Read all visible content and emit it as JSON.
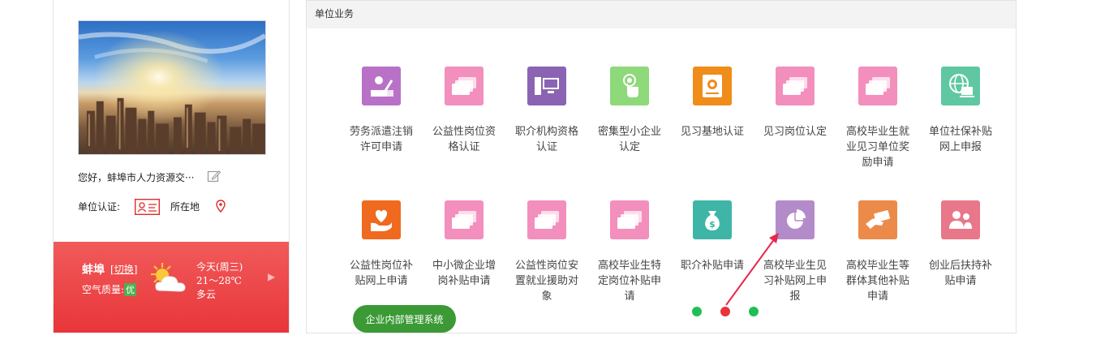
{
  "profile": {
    "greeting": "您好，蚌埠市人力资源交···",
    "cert_label": "单位认证:",
    "location_label": "所在地"
  },
  "weather": {
    "city": "蚌埠",
    "switch_label": "切换",
    "air_quality_label": "空气质量:",
    "air_quality_value": "优",
    "day": "今天(周三)",
    "temp": "21～28℃",
    "condition": "多云"
  },
  "panel": {
    "title": "单位业务",
    "tiles": [
      {
        "label": "劳务派遣注销许可申请",
        "color": "#b871c7",
        "icon": "worker-desk-icon"
      },
      {
        "label": "公益性岗位资格认证",
        "color": "#f38fbd",
        "icon": "cards-icon"
      },
      {
        "label": "职介机构资格认证",
        "color": "#8b63b3",
        "icon": "computer-icon"
      },
      {
        "label": "密集型小企业认定",
        "color": "#8ed97a",
        "icon": "touch-icon"
      },
      {
        "label": "见习基地认证",
        "color": "#f08c1a",
        "icon": "safe-icon"
      },
      {
        "label": "见习岗位认定",
        "color": "#f38fbd",
        "icon": "cards-icon"
      },
      {
        "label": "高校毕业生就业见习单位奖励申请",
        "color": "#f38fbd",
        "icon": "cards-icon"
      },
      {
        "label": "单位社保补贴网上申报",
        "color": "#5fc8a2",
        "icon": "globe-computer-icon"
      },
      {
        "label": "公益性岗位补贴网上申请",
        "color": "#ef6a1f",
        "icon": "heart-hand-icon"
      },
      {
        "label": "中小微企业增岗补贴申请",
        "color": "#f38fbd",
        "icon": "cards-icon"
      },
      {
        "label": "公益性岗位安置就业援助对象",
        "color": "#f38fbd",
        "icon": "cards-icon"
      },
      {
        "label": "高校毕业生特定岗位补贴申请",
        "color": "#f38fbd",
        "icon": "cards-icon"
      },
      {
        "label": "职介补贴申请",
        "color": "#3fb5a8",
        "icon": "money-bag-icon"
      },
      {
        "label": "高校毕业生见习补贴网上申报",
        "color": "#b48bc9",
        "icon": "pie-chart-icon"
      },
      {
        "label": "高校毕业生等群体其他补贴申请",
        "color": "#ec8a4a",
        "icon": "money-hand-icon"
      },
      {
        "label": "创业后扶持补贴申请",
        "color": "#e8778a",
        "icon": "people-icon"
      }
    ],
    "mgmt_button": "企业内部管理系统",
    "dots": [
      {
        "color": "#1fbf56",
        "active": false
      },
      {
        "color": "#e8353a",
        "active": true
      },
      {
        "color": "#1fbf56",
        "active": false
      }
    ]
  }
}
